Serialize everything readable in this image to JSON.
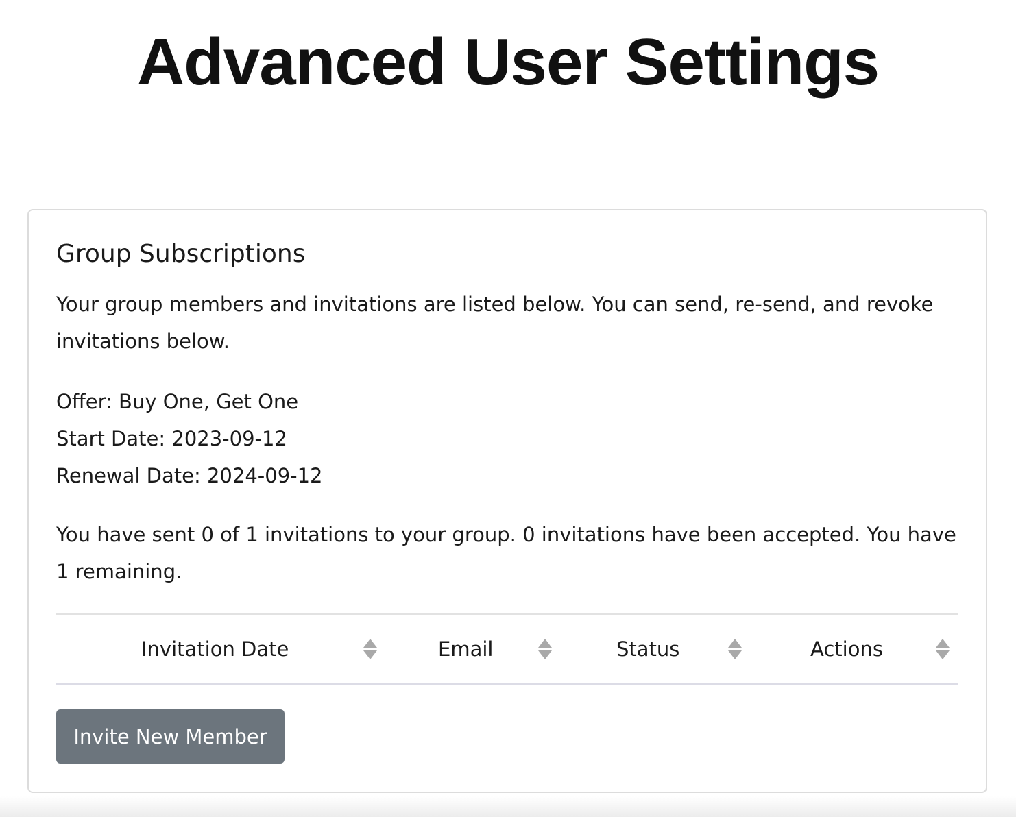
{
  "page": {
    "title": "Advanced User Settings"
  },
  "card": {
    "title": "Group Subscriptions",
    "description": "Your group members and invitations are listed below. You can send, re-send, and revoke invitations below.",
    "offer": "Offer: Buy One, Get One",
    "start_date": "Start Date: 2023-09-12",
    "renewal_date": "Renewal Date: 2024-09-12",
    "invitation_summary": "You have sent 0 of 1 invitations to your group. 0 invitations have been accepted. You have 1 remaining."
  },
  "table": {
    "columns": [
      {
        "label": "Invitation Date",
        "icon": "sort-icon"
      },
      {
        "label": "Email",
        "icon": "sort-icon"
      },
      {
        "label": "Status",
        "icon": "sort-icon"
      },
      {
        "label": "Actions",
        "icon": "sort-icon"
      }
    ],
    "rows": []
  },
  "actions": {
    "invite_button": "Invite New Member"
  },
  "colors": {
    "button_bg": "#6c757d",
    "sort_icon": "#a9a9a9"
  }
}
